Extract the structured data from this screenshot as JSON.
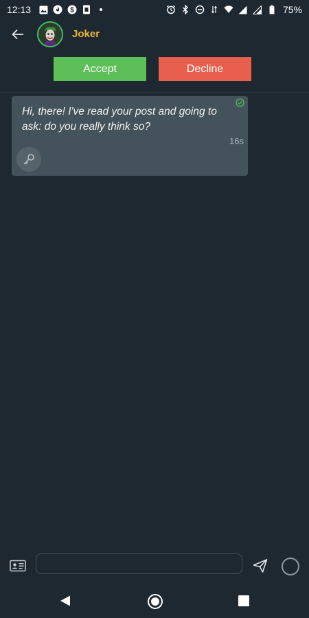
{
  "status_bar": {
    "time": "12:13",
    "battery": "75%",
    "left_icons": [
      "image-icon",
      "fire-icon",
      "dollar-icon",
      "sim-icon",
      "dot-icon"
    ],
    "right_icons": [
      "alarm-icon",
      "bluetooth-icon",
      "dnd-icon",
      "data-icon",
      "wifi-icon",
      "signal-icon",
      "signal-2-icon",
      "battery-icon"
    ]
  },
  "header": {
    "contact_name": "Joker",
    "name_color": "#f2b531"
  },
  "actions": {
    "accept_label": "Accept",
    "decline_label": "Decline",
    "accept_color": "#5cbf57",
    "decline_color": "#e8604d"
  },
  "messages": [
    {
      "text": "Hi, there! I've read your post and going to ask: do you really think so?",
      "time": "16s",
      "status_icon": "check-circle-icon",
      "action_icon": "key-icon"
    }
  ],
  "composer": {
    "input_value": "",
    "attach_icon": "id-card-icon",
    "send_icon": "send-icon",
    "record_icon": "circle-icon"
  },
  "navigation": {
    "icons": [
      "nav-back-icon",
      "nav-home-icon",
      "nav-recents-icon"
    ]
  },
  "colors": {
    "background": "#1e2830",
    "bubble": "#44525b",
    "accent_green": "#3ec26a"
  }
}
